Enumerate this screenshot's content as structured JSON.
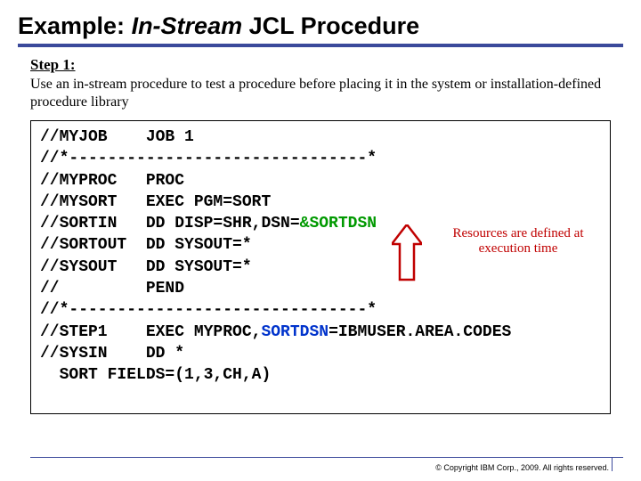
{
  "title_prefix": "Example: ",
  "title_italic": "In-Stream",
  "title_suffix": " JCL Procedure",
  "step_label": "Step 1:",
  "step_desc": "Use an in-stream procedure to test a procedure before placing it in the system or installation-defined procedure library",
  "code": {
    "l1a": "//MYJOB    JOB 1",
    "l2a": "//*-------------------------------*",
    "l3a": "//MYPROC   PROC",
    "l4a": "//MYSORT   EXEC PGM=SORT",
    "l5a": "//SORTIN   DD DISP=SHR,DSN=",
    "l5b": "&SORTDSN",
    "l6a": "//SORTOUT  DD SYSOUT=*",
    "l7a": "//SYSOUT   DD SYSOUT=*",
    "l8a": "//         PEND",
    "l9a": "//*-------------------------------*",
    "l10a": "//STEP1    EXEC MYPROC,",
    "l10b": "SORTDSN",
    "l10c": "=IBMUSER.AREA.CODES",
    "l11a": "//SYSIN    DD *",
    "l12a": "  SORT FIELDS=(1,3,CH,A)"
  },
  "annotation": "Resources are defined at execution time",
  "footer": "© Copyright IBM Corp., 2009. All rights reserved."
}
